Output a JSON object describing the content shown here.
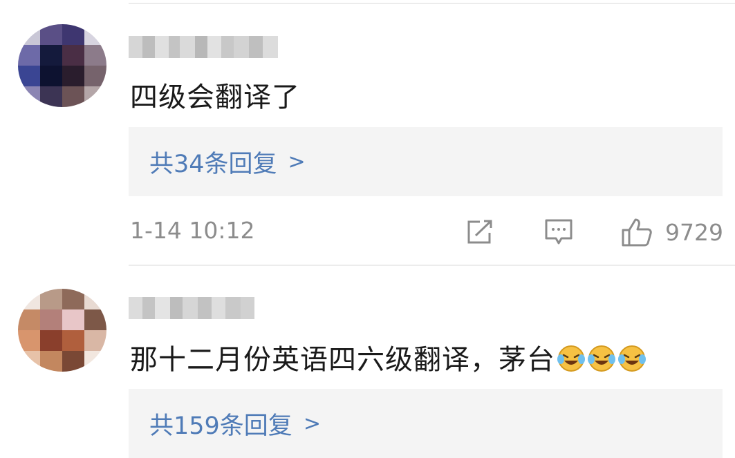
{
  "comments": [
    {
      "text": "四级会翻译了",
      "reply_label": "共34条回复",
      "reply_chevron": ">",
      "time": "1-14 10:12",
      "likes": "9729",
      "share_icon": "share-icon",
      "comment_icon": "comment-icon",
      "like_icon": "thumbs-up-icon"
    },
    {
      "text": "那十二月份英语四六级翻译，茅台",
      "emoji": [
        "laugh-cry-emoji",
        "laugh-cry-emoji",
        "laugh-cry-emoji"
      ],
      "reply_label": "共159条回复",
      "reply_chevron": ">"
    }
  ],
  "colors": {
    "link": "#4f7bb7",
    "meta_text": "#8c8c8c",
    "reply_bg": "#f4f4f4",
    "body_text": "#1a1a1a"
  }
}
